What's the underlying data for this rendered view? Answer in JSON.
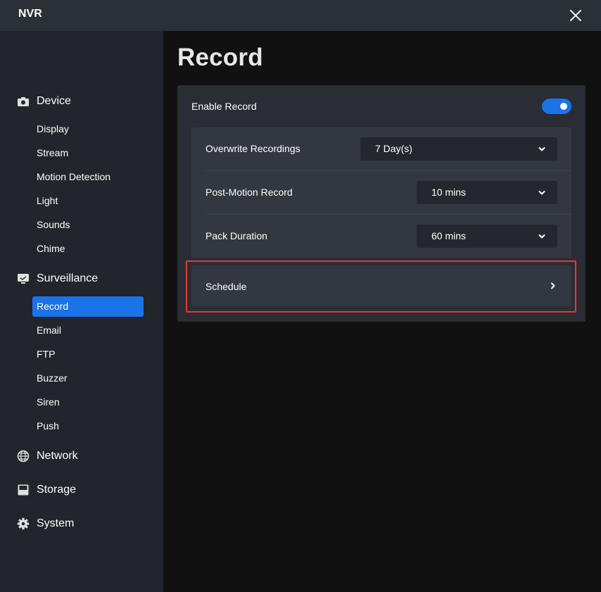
{
  "app": {
    "title": "NVR"
  },
  "sidebar": {
    "device": {
      "label": "Device",
      "items": [
        "Display",
        "Stream",
        "Motion Detection",
        "Light",
        "Sounds",
        "Chime"
      ]
    },
    "surveillance": {
      "label": "Surveillance",
      "items": [
        "Record",
        "Email",
        "FTP",
        "Buzzer",
        "Siren",
        "Push"
      ],
      "active_item": "Record"
    },
    "network": {
      "label": "Network"
    },
    "storage": {
      "label": "Storage"
    },
    "system": {
      "label": "System"
    }
  },
  "main": {
    "title": "Record",
    "enable_record": {
      "label": "Enable Record",
      "enabled": true
    },
    "overwrite_recordings": {
      "label": "Overwrite Recordings",
      "value": "7 Day(s)"
    },
    "post_motion_record": {
      "label": "Post-Motion Record",
      "value": "10 mins"
    },
    "pack_duration": {
      "label": "Pack Duration",
      "value": "60 mins"
    },
    "schedule": {
      "label": "Schedule"
    }
  },
  "colors": {
    "accent": "#1a73e8",
    "highlight_border": "#e53935",
    "sidebar_bg": "#22252b",
    "titlebar_bg": "#2b2f36",
    "main_bg": "#111111"
  },
  "icons": {
    "device": "camera-icon",
    "surveillance": "monitor-icon",
    "network": "globe-icon",
    "storage": "disk-icon",
    "system": "gear-icon",
    "close": "close-icon",
    "dropdown": "chevron-down-icon",
    "schedule": "chevron-right-icon"
  }
}
